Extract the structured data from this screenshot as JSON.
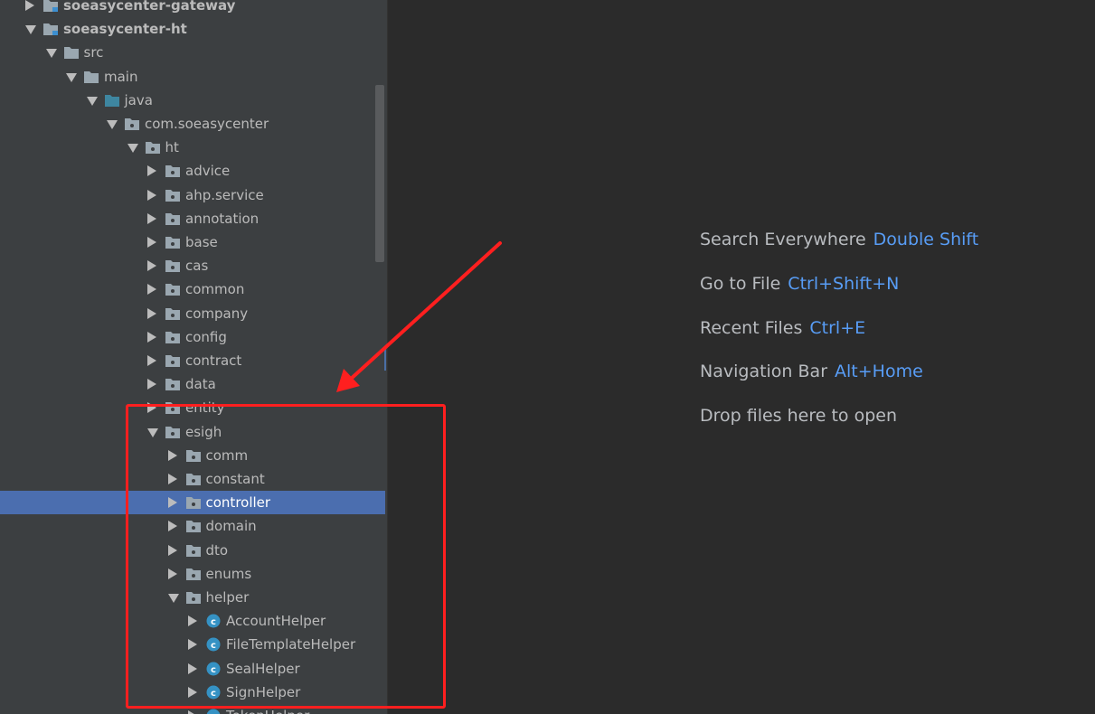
{
  "project_tree": {
    "rows": [
      {
        "label": "soeasycenter-gateway",
        "state": "collapsed",
        "icon": "module-folder-icon",
        "bold": true
      },
      {
        "label": "soeasycenter-ht",
        "state": "expanded",
        "icon": "module-folder-icon",
        "bold": true
      },
      {
        "label": "src",
        "state": "expanded",
        "icon": "folder-icon"
      },
      {
        "label": "main",
        "state": "expanded",
        "icon": "folder-icon"
      },
      {
        "label": "java",
        "state": "expanded",
        "icon": "source-root-folder-icon"
      },
      {
        "label": "com.soeasycenter",
        "state": "expanded",
        "icon": "package-icon"
      },
      {
        "label": "ht",
        "state": "expanded",
        "icon": "package-icon"
      },
      {
        "label": "advice",
        "state": "collapsed",
        "icon": "package-icon"
      },
      {
        "label": "ahp.service",
        "state": "collapsed",
        "icon": "package-icon"
      },
      {
        "label": "annotation",
        "state": "collapsed",
        "icon": "package-icon"
      },
      {
        "label": "base",
        "state": "collapsed",
        "icon": "package-icon"
      },
      {
        "label": "cas",
        "state": "collapsed",
        "icon": "package-icon"
      },
      {
        "label": "common",
        "state": "collapsed",
        "icon": "package-icon"
      },
      {
        "label": "company",
        "state": "collapsed",
        "icon": "package-icon"
      },
      {
        "label": "config",
        "state": "collapsed",
        "icon": "package-icon"
      },
      {
        "label": "contract",
        "state": "collapsed",
        "icon": "package-icon"
      },
      {
        "label": "data",
        "state": "collapsed",
        "icon": "package-icon"
      },
      {
        "label": "entity",
        "state": "collapsed",
        "icon": "package-icon"
      },
      {
        "label": "esigh",
        "state": "expanded",
        "icon": "package-icon"
      },
      {
        "label": "comm",
        "state": "collapsed",
        "icon": "package-icon"
      },
      {
        "label": "constant",
        "state": "collapsed",
        "icon": "package-icon"
      },
      {
        "label": "controller",
        "state": "collapsed",
        "icon": "package-icon",
        "selected": true
      },
      {
        "label": "domain",
        "state": "collapsed",
        "icon": "package-icon"
      },
      {
        "label": "dto",
        "state": "collapsed",
        "icon": "package-icon"
      },
      {
        "label": "enums",
        "state": "collapsed",
        "icon": "package-icon"
      },
      {
        "label": "helper",
        "state": "expanded",
        "icon": "package-icon"
      },
      {
        "label": "AccountHelper",
        "state": "collapsed",
        "icon": "class-icon"
      },
      {
        "label": "FileTemplateHelper",
        "state": "collapsed",
        "icon": "class-icon"
      },
      {
        "label": "SealHelper",
        "state": "collapsed",
        "icon": "class-icon"
      },
      {
        "label": "SignHelper",
        "state": "collapsed",
        "icon": "class-icon"
      },
      {
        "label": "TokenHelper",
        "state": "collapsed",
        "icon": "class-icon"
      }
    ]
  },
  "editor_placeholder": {
    "hints": [
      {
        "text": "Search Everywhere",
        "key": "Double Shift"
      },
      {
        "text": "Go to File",
        "key": "Ctrl+Shift+N"
      },
      {
        "text": "Recent Files",
        "key": "Ctrl+E"
      },
      {
        "text": "Navigation Bar",
        "key": "Alt+Home"
      },
      {
        "text": "Drop files here to open",
        "key": ""
      }
    ]
  },
  "colors": {
    "panel_bg": "#3c3f41",
    "editor_bg": "#2b2b2b",
    "selection": "#4b6eaf",
    "shortcut": "#589df6",
    "annotation_red": "#ff1f1f"
  }
}
